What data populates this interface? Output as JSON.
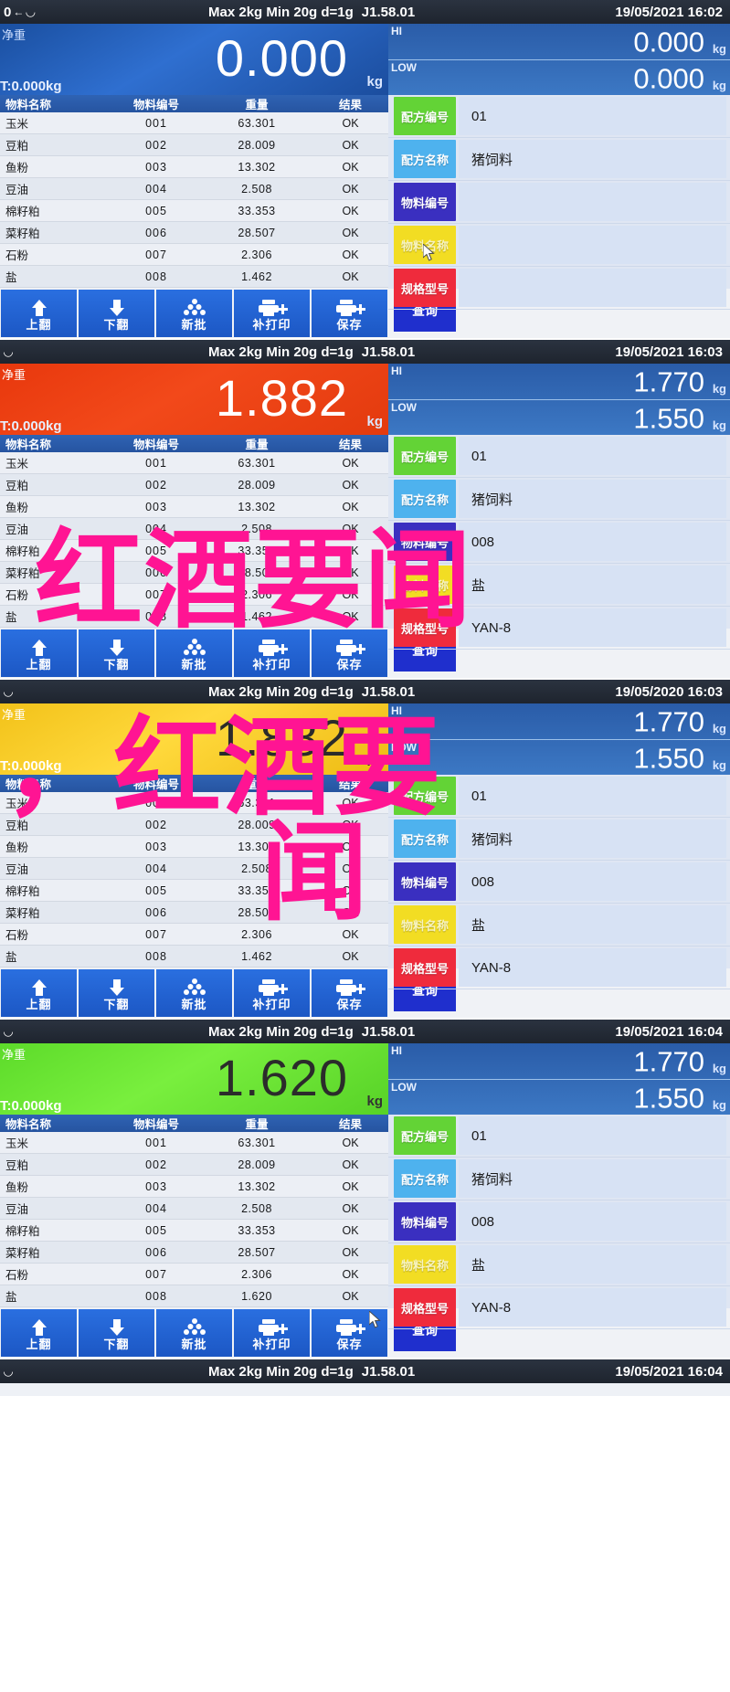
{
  "device": {
    "spec_text": "Max 2kg  Min 20g  d=1g",
    "firmware": "J1.58.01",
    "zero_symbol": "0",
    "arrow_symbol": "←",
    "cup_symbol": "◡",
    "net_label": "净重",
    "unit_kg": "kg",
    "hi_tag": "HI",
    "low_tag": "LOW"
  },
  "table": {
    "headers": [
      "物料名称",
      "物料编号",
      "重量",
      "结果"
    ],
    "rows_a": [
      {
        "name": "玉米",
        "no": "001",
        "weight": "63.301",
        "result": "OK"
      },
      {
        "name": "豆粕",
        "no": "002",
        "weight": "28.009",
        "result": "OK"
      },
      {
        "name": "鱼粉",
        "no": "003",
        "weight": "13.302",
        "result": "OK"
      },
      {
        "name": "豆油",
        "no": "004",
        "weight": "2.508",
        "result": "OK"
      },
      {
        "name": "棉籽粕",
        "no": "005",
        "weight": "33.353",
        "result": "OK"
      },
      {
        "name": "菜籽粕",
        "no": "006",
        "weight": "28.507",
        "result": "OK"
      },
      {
        "name": "石粉",
        "no": "007",
        "weight": "2.306",
        "result": "OK"
      },
      {
        "name": "盐",
        "no": "008",
        "weight": "1.462",
        "result": "OK"
      }
    ],
    "rows_b": [
      {
        "name": "玉米",
        "no": "001",
        "weight": "63.301",
        "result": "OK"
      },
      {
        "name": "豆粕",
        "no": "002",
        "weight": "28.009",
        "result": "OK"
      },
      {
        "name": "鱼粉",
        "no": "003",
        "weight": "13.302",
        "result": "OK"
      },
      {
        "name": "豆油",
        "no": "004",
        "weight": "2.508",
        "result": "OK"
      },
      {
        "name": "棉籽粕",
        "no": "005",
        "weight": "33.353",
        "result": "OK"
      },
      {
        "name": "菜籽粕",
        "no": "006",
        "weight": "28.507",
        "result": "OK"
      },
      {
        "name": "石粉",
        "no": "007",
        "weight": "2.306",
        "result": "OK"
      },
      {
        "name": "盐",
        "no": "008",
        "weight": "1.620",
        "result": "OK"
      }
    ]
  },
  "side_keys": {
    "formula_no": "配方编号",
    "formula_name": "配方名称",
    "material_no": "物料编号",
    "material_name": "物料名称",
    "spec_model": "规格型号"
  },
  "buttons": {
    "page_up": "上翻",
    "page_down": "下翻",
    "new_batch": "新批",
    "reprint": "补打印",
    "save": "保存",
    "query": "查询"
  },
  "panels": [
    {
      "id": "panel-1",
      "datetime": "19/05/2021  16:02",
      "weight": "0.000",
      "weight_color": "blue",
      "tare": "T:0.000kg",
      "hi": "0.000",
      "low": "0.000",
      "side_values": {
        "formula_no": "01",
        "formula_name": "猪饲料",
        "material_no": "",
        "material_name": "",
        "spec_model": ""
      },
      "cursor_on": "material-name-key"
    },
    {
      "id": "panel-2",
      "datetime": "19/05/2021  16:03",
      "weight": "1.882",
      "weight_color": "red",
      "tare": "T:0.000kg",
      "hi": "1.770",
      "low": "1.550",
      "side_values": {
        "formula_no": "01",
        "formula_name": "猪饲料",
        "material_no": "008",
        "material_name": "盐",
        "spec_model": "YAN-8"
      },
      "cursor_on": ""
    },
    {
      "id": "panel-3",
      "datetime": "19/05/2020  16:03",
      "weight": "1.882",
      "weight_color": "yellow",
      "tare": "T:0.000kg",
      "hi": "1.770",
      "low": "1.550",
      "side_values": {
        "formula_no": "01",
        "formula_name": "猪饲料",
        "material_no": "008",
        "material_name": "盐",
        "spec_model": "YAN-8"
      },
      "cursor_on": ""
    },
    {
      "id": "panel-4",
      "datetime": "19/05/2021  16:04",
      "weight": "1.620",
      "weight_color": "green",
      "tare": "T:0.000kg",
      "hi": "1.770",
      "low": "1.550",
      "side_values": {
        "formula_no": "01",
        "formula_name": "猪饲料",
        "material_no": "008",
        "material_name": "盐",
        "spec_model": "YAN-8"
      },
      "cursor_on": "save-button"
    },
    {
      "id": "panel-5",
      "datetime": "19/05/2021  16:04",
      "weight": "",
      "weight_color": "blue",
      "tare": "",
      "hi": "",
      "low": "",
      "side_values": {},
      "cursor_on": ""
    }
  ],
  "watermark": {
    "line1": "红酒要闻",
    "line2": "，红酒要",
    "line3": "闻",
    "color": "#ff1493"
  }
}
